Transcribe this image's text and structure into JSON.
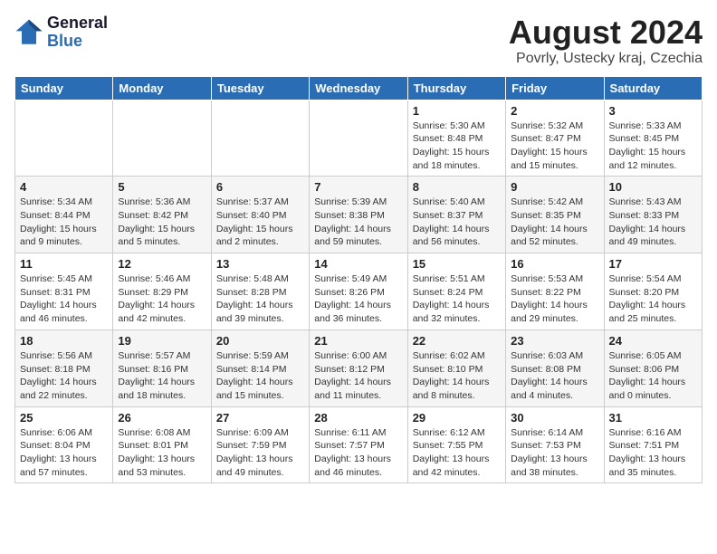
{
  "header": {
    "logo_line1": "General",
    "logo_line2": "Blue",
    "title": "August 2024",
    "subtitle": "Povrly, Ustecky kraj, Czechia"
  },
  "weekdays": [
    "Sunday",
    "Monday",
    "Tuesday",
    "Wednesday",
    "Thursday",
    "Friday",
    "Saturday"
  ],
  "weeks": [
    [
      {
        "day": "",
        "info": ""
      },
      {
        "day": "",
        "info": ""
      },
      {
        "day": "",
        "info": ""
      },
      {
        "day": "",
        "info": ""
      },
      {
        "day": "1",
        "info": "Sunrise: 5:30 AM\nSunset: 8:48 PM\nDaylight: 15 hours\nand 18 minutes."
      },
      {
        "day": "2",
        "info": "Sunrise: 5:32 AM\nSunset: 8:47 PM\nDaylight: 15 hours\nand 15 minutes."
      },
      {
        "day": "3",
        "info": "Sunrise: 5:33 AM\nSunset: 8:45 PM\nDaylight: 15 hours\nand 12 minutes."
      }
    ],
    [
      {
        "day": "4",
        "info": "Sunrise: 5:34 AM\nSunset: 8:44 PM\nDaylight: 15 hours\nand 9 minutes."
      },
      {
        "day": "5",
        "info": "Sunrise: 5:36 AM\nSunset: 8:42 PM\nDaylight: 15 hours\nand 5 minutes."
      },
      {
        "day": "6",
        "info": "Sunrise: 5:37 AM\nSunset: 8:40 PM\nDaylight: 15 hours\nand 2 minutes."
      },
      {
        "day": "7",
        "info": "Sunrise: 5:39 AM\nSunset: 8:38 PM\nDaylight: 14 hours\nand 59 minutes."
      },
      {
        "day": "8",
        "info": "Sunrise: 5:40 AM\nSunset: 8:37 PM\nDaylight: 14 hours\nand 56 minutes."
      },
      {
        "day": "9",
        "info": "Sunrise: 5:42 AM\nSunset: 8:35 PM\nDaylight: 14 hours\nand 52 minutes."
      },
      {
        "day": "10",
        "info": "Sunrise: 5:43 AM\nSunset: 8:33 PM\nDaylight: 14 hours\nand 49 minutes."
      }
    ],
    [
      {
        "day": "11",
        "info": "Sunrise: 5:45 AM\nSunset: 8:31 PM\nDaylight: 14 hours\nand 46 minutes."
      },
      {
        "day": "12",
        "info": "Sunrise: 5:46 AM\nSunset: 8:29 PM\nDaylight: 14 hours\nand 42 minutes."
      },
      {
        "day": "13",
        "info": "Sunrise: 5:48 AM\nSunset: 8:28 PM\nDaylight: 14 hours\nand 39 minutes."
      },
      {
        "day": "14",
        "info": "Sunrise: 5:49 AM\nSunset: 8:26 PM\nDaylight: 14 hours\nand 36 minutes."
      },
      {
        "day": "15",
        "info": "Sunrise: 5:51 AM\nSunset: 8:24 PM\nDaylight: 14 hours\nand 32 minutes."
      },
      {
        "day": "16",
        "info": "Sunrise: 5:53 AM\nSunset: 8:22 PM\nDaylight: 14 hours\nand 29 minutes."
      },
      {
        "day": "17",
        "info": "Sunrise: 5:54 AM\nSunset: 8:20 PM\nDaylight: 14 hours\nand 25 minutes."
      }
    ],
    [
      {
        "day": "18",
        "info": "Sunrise: 5:56 AM\nSunset: 8:18 PM\nDaylight: 14 hours\nand 22 minutes."
      },
      {
        "day": "19",
        "info": "Sunrise: 5:57 AM\nSunset: 8:16 PM\nDaylight: 14 hours\nand 18 minutes."
      },
      {
        "day": "20",
        "info": "Sunrise: 5:59 AM\nSunset: 8:14 PM\nDaylight: 14 hours\nand 15 minutes."
      },
      {
        "day": "21",
        "info": "Sunrise: 6:00 AM\nSunset: 8:12 PM\nDaylight: 14 hours\nand 11 minutes."
      },
      {
        "day": "22",
        "info": "Sunrise: 6:02 AM\nSunset: 8:10 PM\nDaylight: 14 hours\nand 8 minutes."
      },
      {
        "day": "23",
        "info": "Sunrise: 6:03 AM\nSunset: 8:08 PM\nDaylight: 14 hours\nand 4 minutes."
      },
      {
        "day": "24",
        "info": "Sunrise: 6:05 AM\nSunset: 8:06 PM\nDaylight: 14 hours\nand 0 minutes."
      }
    ],
    [
      {
        "day": "25",
        "info": "Sunrise: 6:06 AM\nSunset: 8:04 PM\nDaylight: 13 hours\nand 57 minutes."
      },
      {
        "day": "26",
        "info": "Sunrise: 6:08 AM\nSunset: 8:01 PM\nDaylight: 13 hours\nand 53 minutes."
      },
      {
        "day": "27",
        "info": "Sunrise: 6:09 AM\nSunset: 7:59 PM\nDaylight: 13 hours\nand 49 minutes."
      },
      {
        "day": "28",
        "info": "Sunrise: 6:11 AM\nSunset: 7:57 PM\nDaylight: 13 hours\nand 46 minutes."
      },
      {
        "day": "29",
        "info": "Sunrise: 6:12 AM\nSunset: 7:55 PM\nDaylight: 13 hours\nand 42 minutes."
      },
      {
        "day": "30",
        "info": "Sunrise: 6:14 AM\nSunset: 7:53 PM\nDaylight: 13 hours\nand 38 minutes."
      },
      {
        "day": "31",
        "info": "Sunrise: 6:16 AM\nSunset: 7:51 PM\nDaylight: 13 hours\nand 35 minutes."
      }
    ]
  ]
}
